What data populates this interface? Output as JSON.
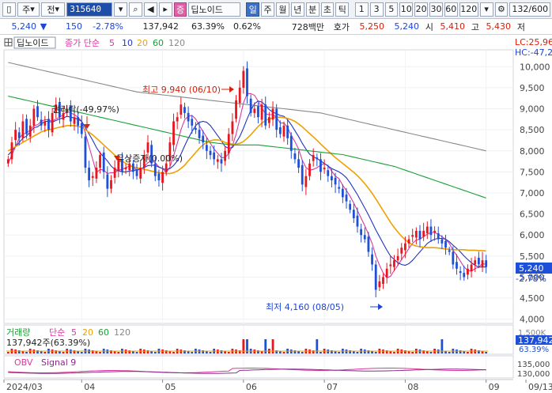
{
  "toolbar": {
    "market": "주",
    "market_select": "전",
    "code": "315640",
    "name": "딥노이드",
    "periods": [
      "일",
      "주",
      "월",
      "년",
      "분",
      "초",
      "틱"
    ],
    "active_period": "일",
    "intervals": [
      "1",
      "3",
      "5",
      "10",
      "20",
      "30",
      "60",
      "120"
    ],
    "count": "132",
    "count_total": "/600"
  },
  "quote": {
    "price": "5,240",
    "change": "150",
    "change_pct": "-2.78%",
    "volume": "137,942",
    "vol_ratio": "63.39%",
    "turnover_pct": "0.62%",
    "amount": "728백만",
    "ask_label": "호가",
    "ask": "5,250",
    "bid": "5,240",
    "open_label": "시",
    "open": "5,410",
    "high_label": "고",
    "high": "5,430",
    "low_label": "저"
  },
  "tab": {
    "name": "딥노이드",
    "ma_label": "종가 단순",
    "ma_periods": [
      "5",
      "10",
      "20",
      "60",
      "120"
    ]
  },
  "corner": {
    "lc": "LC:25,96",
    "hc": "HC:-47,2"
  },
  "colors": {
    "ma5": "#d83a9e",
    "ma10": "#2234c0",
    "ma20": "#f0a000",
    "ma60": "#19a035",
    "ma120": "#888888",
    "up": "#e8141e",
    "down": "#1d4fd8"
  },
  "annotations": {
    "high": "최고 9,940 (06/10)",
    "low": "최저 4,160 (08/05)",
    "rights": "권리락(-49,97%)",
    "bonus": "무상증자(0.00%)"
  },
  "price_badge": {
    "price": "5,240",
    "pct": "-2.78%"
  },
  "volume_panel": {
    "label": "거래량",
    "ma_label": "단순",
    "ma_periods": [
      "5",
      "20",
      "60",
      "120"
    ],
    "value": "137,942주(63.39%)",
    "badge": "137,942",
    "badge_pct": "63.39%",
    "top_tick": "1,500K"
  },
  "obv_panel": {
    "label": "OBV",
    "signal": "Signal 9",
    "ticks": [
      "135,000",
      "130,000"
    ]
  },
  "chart_data": {
    "type": "candlestick",
    "x_ticks": [
      "2024/03",
      "04",
      "05",
      "06",
      "07",
      "08",
      "09",
      "09/13"
    ],
    "y_ticks": [
      "10,000",
      "9,500",
      "9,000",
      "8,500",
      "8,000",
      "7,500",
      "7,000",
      "6,500",
      "6,000",
      "5,500",
      "5,000",
      "4,500",
      "4,000"
    ],
    "ylim": [
      3900,
      10400
    ],
    "closes": [
      7800,
      8200,
      8500,
      8300,
      8700,
      8400,
      8600,
      9000,
      8800,
      8600,
      8700,
      8500,
      8900,
      9100,
      8800,
      8900,
      9000,
      8700,
      8800,
      8600,
      8400,
      7600,
      7300,
      7400,
      7600,
      7900,
      7500,
      7100,
      7300,
      7600,
      7800,
      7500,
      7600,
      7700,
      7500,
      7400,
      7600,
      7900,
      8200,
      7700,
      7400,
      7300,
      7500,
      7700,
      8200,
      8700,
      8800,
      9100,
      8900,
      8700,
      8600,
      8500,
      8300,
      8200,
      8000,
      7900,
      7800,
      7800,
      7700,
      8000,
      8400,
      8700,
      9200,
      9500,
      9900,
      9300,
      8900,
      9000,
      8800,
      9100,
      8600,
      8800,
      9000,
      8500,
      8400,
      8600,
      8300,
      8000,
      7800,
      7600,
      7200,
      7400,
      7700,
      7900,
      7800,
      7500,
      7600,
      7400,
      7300,
      7200,
      7100,
      6900,
      6800,
      6600,
      6400,
      6200,
      6000,
      5900,
      5600,
      5300,
      4700,
      4900,
      5000,
      5200,
      5300,
      5400,
      5500,
      5700,
      5800,
      5900,
      6000,
      6100,
      5900,
      6100,
      6200,
      6000,
      6100,
      5900,
      5800,
      5700,
      5600,
      5300,
      5200,
      5100,
      5000,
      5200,
      5300,
      5400,
      5300,
      5400,
      5240
    ],
    "series": [
      {
        "name": "5",
        "values": [
          7700,
          7900,
          8100,
          8300,
          8400,
          8420,
          8500,
          8600,
          8620,
          8700,
          8740,
          8740,
          8700,
          8760,
          8800,
          8860,
          8940,
          8900,
          8860,
          8800,
          8700,
          8420,
          8100,
          7800,
          7480,
          7560,
          7540,
          7460,
          7480,
          7480,
          7540,
          7560,
          7600,
          7640,
          7620,
          7540,
          7560,
          7620,
          7720,
          7760,
          7720,
          7620,
          7580,
          7480,
          7620,
          7880,
          8180,
          8500,
          8740,
          8820,
          8840,
          8760,
          8600,
          8460,
          8320,
          8180,
          8040,
          7940,
          7840,
          7840,
          7940,
          8120,
          8400,
          8760,
          9140,
          9360,
          9360,
          9320,
          9180,
          9020,
          8880,
          8860,
          8860,
          8800,
          8660,
          8660,
          8560,
          8360,
          8220,
          8040,
          7780,
          7600,
          7540,
          7560,
          7600,
          7660,
          7700,
          7640,
          7520,
          7400,
          7340,
          7180,
          7060,
          6920,
          6760,
          6580,
          6400,
          6220,
          6020,
          5800,
          5500,
          5280,
          5100,
          4980,
          5020,
          5160,
          5280,
          5420,
          5540,
          5680,
          5800,
          5880,
          5900,
          5960,
          6020,
          6060,
          6060,
          6020,
          5960,
          5900,
          5800,
          5640,
          5520,
          5380,
          5240,
          5160,
          5140,
          5200,
          5240,
          5320,
          5300
        ]
      },
      {
        "name": "10",
        "values": [
          7900,
          8000,
          8100,
          8200,
          8300,
          8350,
          8450,
          8550,
          8570,
          8640,
          8700,
          8700,
          8680,
          8720,
          8760,
          8780,
          8820,
          8800,
          8780,
          8750,
          8700,
          8550,
          8400,
          8250,
          8080,
          7950,
          7860,
          7760,
          7640,
          7560,
          7530,
          7500,
          7500,
          7520,
          7530,
          7550,
          7570,
          7600,
          7650,
          7660,
          7660,
          7610,
          7580,
          7550,
          7580,
          7650,
          7760,
          7920,
          8120,
          8300,
          8460,
          8600,
          8680,
          8700,
          8680,
          8600,
          8480,
          8360,
          8240,
          8100,
          8060,
          8080,
          8200,
          8340,
          8540,
          8760,
          8960,
          9120,
          9180,
          9160,
          9080,
          8980,
          8920,
          8880,
          8840,
          8820,
          8740,
          8620,
          8480,
          8340,
          8180,
          8040,
          7920,
          7860,
          7820,
          7760,
          7700,
          7640,
          7580,
          7540,
          7500,
          7440,
          7360,
          7240,
          7100,
          6960,
          6800,
          6640,
          6480,
          6300,
          6120,
          5960,
          5800,
          5640,
          5500,
          5420,
          5340,
          5300,
          5280,
          5320,
          5400,
          5500,
          5600,
          5700,
          5800,
          5860,
          5900,
          5920,
          5920,
          5900,
          5840,
          5760,
          5680,
          5600,
          5500,
          5420,
          5340,
          5280,
          5240,
          5240,
          5240
        ]
      },
      {
        "name": "20",
        "values": [
          8000,
          8050,
          8100,
          8150,
          8200,
          8250,
          8300,
          8350,
          8400,
          8450,
          8480,
          8500,
          8520,
          8540,
          8560,
          8580,
          8600,
          8600,
          8600,
          8580,
          8560,
          8500,
          8440,
          8380,
          8300,
          8220,
          8140,
          8060,
          7980,
          7900,
          7820,
          7760,
          7700,
          7660,
          7620,
          7600,
          7580,
          7560,
          7540,
          7520,
          7500,
          7480,
          7470,
          7460,
          7460,
          7480,
          7520,
          7580,
          7660,
          7760,
          7860,
          7960,
          8060,
          8140,
          8200,
          8240,
          8260,
          8260,
          8240,
          8200,
          8180,
          8160,
          8160,
          8180,
          8220,
          8300,
          8380,
          8480,
          8580,
          8660,
          8720,
          8760,
          8780,
          8800,
          8800,
          8790,
          8770,
          8740,
          8700,
          8640,
          8570,
          8490,
          8410,
          8330,
          8250,
          8160,
          8080,
          8000,
          7920,
          7840,
          7770,
          7700,
          7630,
          7560,
          7490,
          7410,
          7320,
          7220,
          7110,
          6990,
          6860,
          6720,
          6580,
          6440,
          6300,
          6180,
          6070,
          5970,
          5890,
          5820,
          5770,
          5740,
          5720,
          5710,
          5700,
          5700,
          5700,
          5690,
          5680,
          5670,
          5660,
          5650,
          5650,
          5650,
          5650,
          5640,
          5640,
          5640,
          5630,
          5630,
          5620
        ]
      },
      {
        "name": "60",
        "values": [
          9300,
          9280,
          9260,
          9240,
          9220,
          9200,
          9180,
          9160,
          9140,
          9120,
          9100,
          9080,
          9060,
          9040,
          9020,
          9000,
          8980,
          8960,
          8940,
          8920,
          8900,
          8880,
          8860,
          8840,
          8820,
          8800,
          8780,
          8760,
          8740,
          8720,
          8700,
          8680,
          8660,
          8640,
          8620,
          8600,
          8580,
          8560,
          8540,
          8520,
          8500,
          8480,
          8460,
          8440,
          8420,
          8400,
          8380,
          8360,
          8340,
          8320,
          8300,
          8280,
          8260,
          8240,
          8220,
          8200,
          8190,
          8180,
          8170,
          8160,
          8150,
          8140,
          8140,
          8140,
          8140,
          8140,
          8140,
          8140,
          8140,
          8130,
          8120,
          8110,
          8100,
          8090,
          8080,
          8070,
          8060,
          8050,
          8040,
          8030,
          8020,
          8010,
          8000,
          7990,
          7980,
          7970,
          7960,
          7950,
          7940,
          7930,
          7920,
          7910,
          7890,
          7870,
          7850,
          7830,
          7810,
          7790,
          7770,
          7750,
          7730,
          7710,
          7690,
          7670,
          7650,
          7630,
          7600,
          7570,
          7540,
          7510,
          7480,
          7450,
          7420,
          7390,
          7360,
          7330,
          7300,
          7270,
          7240,
          7210,
          7180,
          7150,
          7120,
          7090,
          7060,
          7030,
          7000,
          6970,
          6940,
          6910,
          6880
        ]
      },
      {
        "name": "120",
        "values": [
          10100,
          10080,
          10060,
          10040,
          10020,
          10000,
          9980,
          9960,
          9940,
          9920,
          9900,
          9880,
          9860,
          9840,
          9820,
          9800,
          9780,
          9760,
          9740,
          9720,
          9700,
          9680,
          9660,
          9640,
          9620,
          9600,
          9580,
          9560,
          9540,
          9520,
          9500,
          9480,
          9460,
          9440,
          9420,
          9400,
          9390,
          9380,
          9370,
          9360,
          9350,
          9340,
          9330,
          9320,
          9310,
          9300,
          9290,
          9280,
          9270,
          9260,
          9250,
          9240,
          9230,
          9220,
          9210,
          9200,
          9190,
          9180,
          9170,
          9160,
          9150,
          9140,
          9130,
          9120,
          9110,
          9100,
          9090,
          9080,
          9070,
          9060,
          9050,
          9040,
          9030,
          9020,
          9010,
          9000,
          8990,
          8980,
          8970,
          8960,
          8950,
          8940,
          8930,
          8920,
          8910,
          8900,
          8880,
          8860,
          8840,
          8820,
          8800,
          8780,
          8760,
          8740,
          8720,
          8700,
          8680,
          8660,
          8640,
          8620,
          8600,
          8580,
          8560,
          8540,
          8520,
          8500,
          8480,
          8460,
          8440,
          8420,
          8400,
          8380,
          8360,
          8340,
          8320,
          8300,
          8280,
          8260,
          8240,
          8220,
          8200,
          8180,
          8160,
          8140,
          8120,
          8100,
          8080,
          8060,
          8040,
          8020,
          8000
        ]
      }
    ]
  }
}
